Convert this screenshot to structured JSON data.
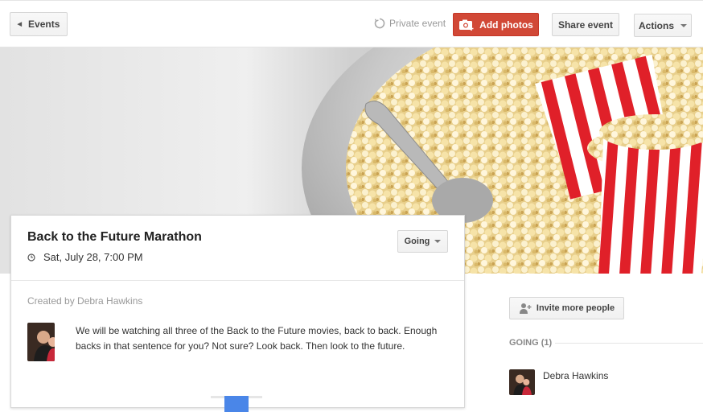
{
  "topbar": {
    "back_label": "Events",
    "private_label": "Private event",
    "add_photos_label": "Add photos",
    "share_label": "Share event",
    "actions_label": "Actions"
  },
  "event": {
    "title": "Back to the Future Marathon",
    "datetime": "Sat, July 28, 7:00 PM",
    "rsvp_label": "Going",
    "created_by": "Created by Debra Hawkins",
    "description": "We will be watching all three of the Back to the Future movies, back to back. Enough backs in that sentence for you? Not sure? Look back. Then look to the future."
  },
  "sidebar": {
    "invite_label": "Invite more people",
    "going_label": "GOING (1)",
    "guests": [
      {
        "name": "Debra Hawkins"
      }
    ]
  },
  "colors": {
    "accent_red": "#d14836",
    "popcorn_stripe_red": "#e02029"
  }
}
